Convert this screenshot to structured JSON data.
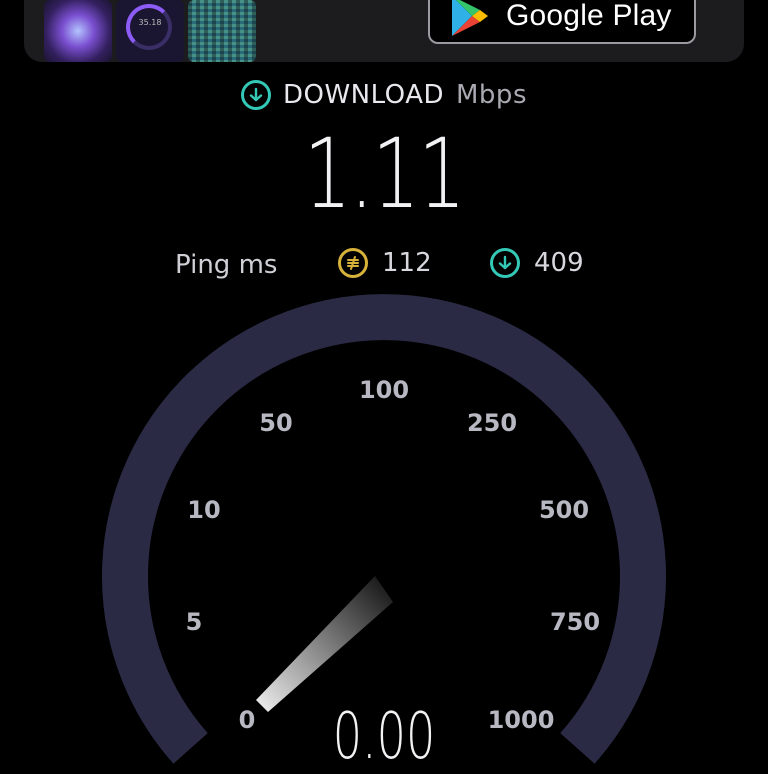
{
  "banner": {
    "store_button_label": "Google Play",
    "thumb2_text": "35.18"
  },
  "download": {
    "label": "DOWNLOAD",
    "unit": "Mbps",
    "value": "1.11"
  },
  "ping": {
    "label": "Ping ms",
    "jitter_value": "112",
    "download_ping_value": "409"
  },
  "gauge": {
    "scale_labels": [
      "0",
      "5",
      "10",
      "50",
      "100",
      "250",
      "500",
      "750",
      "1000"
    ],
    "current_value": 0.0,
    "readout": "0.00",
    "colors": {
      "track": "#2a2a44",
      "download_accent": "#33c9b6",
      "ping_accent": "#d7b23a"
    }
  }
}
